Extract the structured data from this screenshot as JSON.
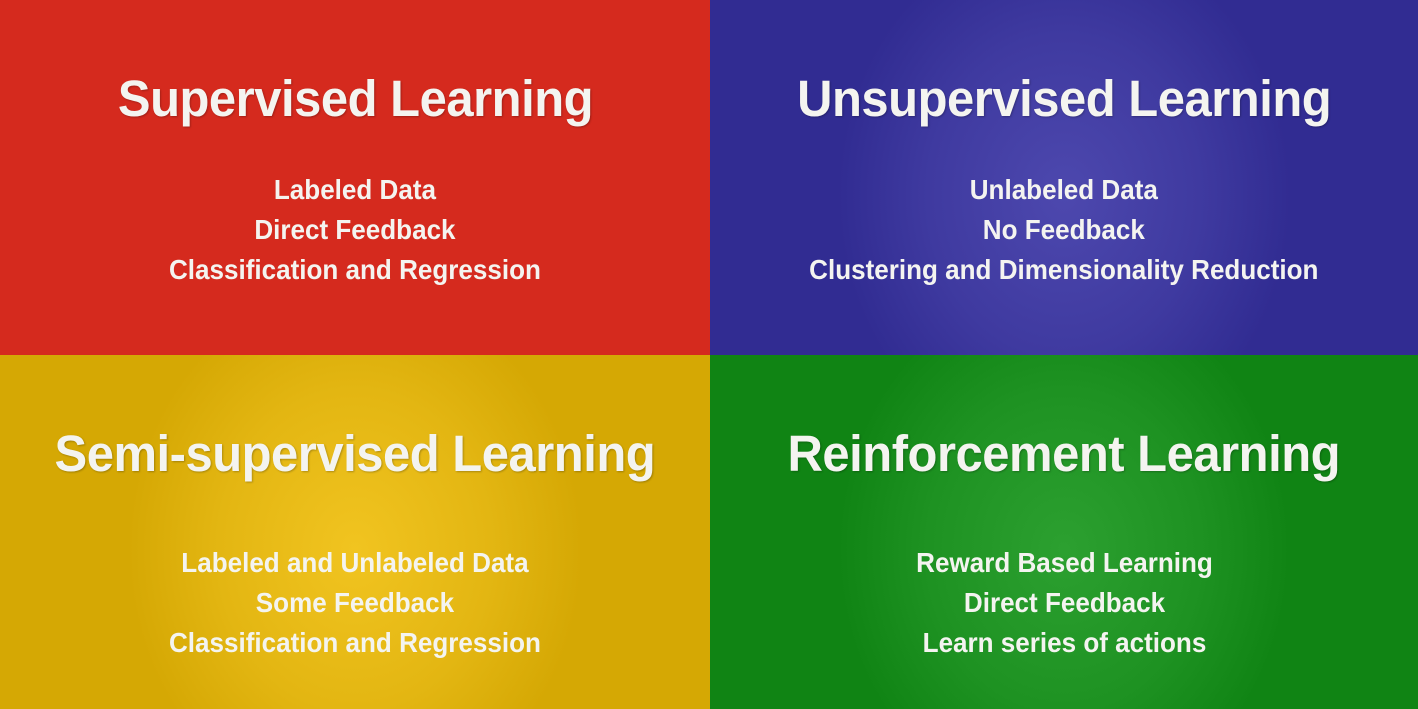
{
  "quadrants": [
    {
      "title": "Supervised Learning",
      "color": "#d52a1e",
      "items": [
        "Labeled Data",
        "Direct Feedback",
        "Classification and Regression"
      ]
    },
    {
      "title": "Unsupervised Learning",
      "color": "#3f3aa0",
      "items": [
        "Unlabeled Data",
        "No Feedback",
        "Clustering and Dimensionality Reduction"
      ]
    },
    {
      "title": "Semi-supervised Learning",
      "color": "#e3b612",
      "items": [
        "Labeled and Unlabeled Data",
        "Some Feedback",
        "Classification and Regression"
      ]
    },
    {
      "title": "Reinforcement Learning",
      "color": "#1e9222",
      "items": [
        "Reward Based Learning",
        "Direct Feedback",
        "Learn series of actions"
      ]
    }
  ]
}
